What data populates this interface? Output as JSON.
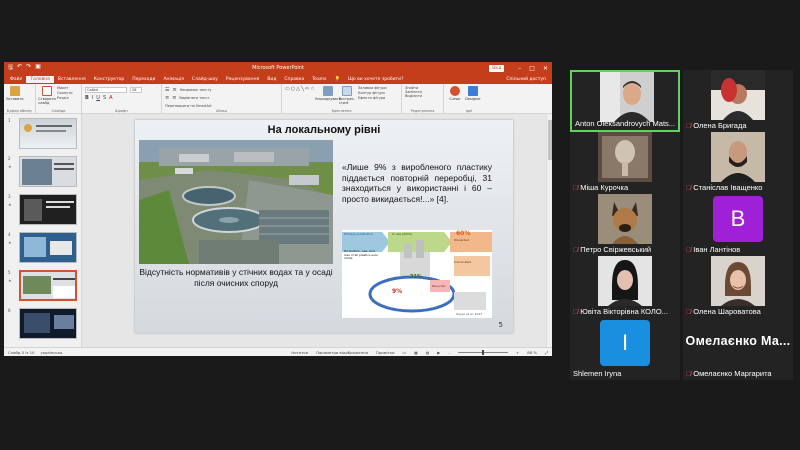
{
  "ppt": {
    "doc_title": "Microsoft PowerPoint",
    "signin": "Вхід",
    "window_buttons": [
      "–",
      "□",
      "✕"
    ],
    "menu": [
      "Файл",
      "Головна",
      "Вставлення",
      "Конструктор",
      "Переходи",
      "Анімація",
      "Слайд-шоу",
      "Рецензування",
      "Вид",
      "Справка",
      "Teams"
    ],
    "active_menu": "Головна",
    "tell_me": "Що ви хочете зробити?",
    "share": "Спільний доступ",
    "ribbon": {
      "paste": "Вставити",
      "new_slide": "Створити слайд",
      "reset": "Скинути",
      "section": "Розділ",
      "layout": "Макет",
      "font_name": "Calibri",
      "font_size": "28",
      "text_dir": "Напрямок тексту",
      "align_text": "Вирівняти текст",
      "smartart": "Перетворити на SmartArt",
      "arrange": "Упорядкувати",
      "quick_styles": "Експрес-стилі",
      "shape_fill": "Заливка фігури",
      "shape_outline": "Контур фігури",
      "shape_effects": "Ефекти фігури",
      "find": "Знайти",
      "replace": "Замінити",
      "select": "Виділити",
      "cursor": "Cursor",
      "designer": "Designer",
      "groups": [
        "Буфер обміну",
        "Слайди",
        "Шрифт",
        "Абзац",
        "Креслення",
        "Редагування",
        "Ідеї"
      ]
    },
    "thumbs": [
      "1",
      "2",
      "3",
      "4",
      "5",
      "6"
    ],
    "slide": {
      "title": "На локальному рівні",
      "quote": "«Лише 9% з виробленого пластику піддається повторній переробці, 31 знаходиться у використанні і 60 – просто викидається!...» [4].",
      "caption": "Відсутність нормативів у стічних водах та у осаді після очисних споруд",
      "number": "5",
      "diagram_labels": [
        "Primary production",
        "Production, use, and loss of all plastics ever made",
        "In use (2015)",
        "Discarded",
        "Incinerated",
        "Recycled",
        "60%",
        "9%",
        "31%",
        "Geyer et al. 2017"
      ]
    },
    "status": {
      "slide_info": "Слайд 5 із 10",
      "language": "українська",
      "notes": "Нотатки",
      "comments": "Параметри відображення",
      "view": "Примітки",
      "zoom": "88 %"
    }
  },
  "participants": [
    {
      "name": "Anton Oleksandrovych Mats...",
      "muted": false,
      "kind": "video",
      "active": true
    },
    {
      "name": "Олена Бригада",
      "muted": true,
      "kind": "video",
      "active": false
    },
    {
      "name": "Міша Курочка",
      "muted": true,
      "kind": "video",
      "active": false
    },
    {
      "name": "Станіслав Іващенко",
      "muted": true,
      "kind": "video",
      "active": false
    },
    {
      "name": "Петро Свіржевський",
      "muted": true,
      "kind": "video",
      "active": false
    },
    {
      "name": "Іван Лантінов",
      "muted": true,
      "kind": "letter",
      "letter": "B",
      "color": "#a020d8",
      "active": false
    },
    {
      "name": "Ювіта Вікторівна КОЛО...",
      "muted": true,
      "kind": "video",
      "active": false
    },
    {
      "name": "Олена Шароватова",
      "muted": true,
      "kind": "video",
      "active": false
    },
    {
      "name": "Shlemen Iryna",
      "muted": false,
      "kind": "letter",
      "letter": "I",
      "color": "#1a8fe0",
      "active": false
    },
    {
      "name": "Омелаєнко Маргарита",
      "muted": true,
      "kind": "bigname",
      "bigname": "Омелаєнко Ма...",
      "active": false
    }
  ]
}
